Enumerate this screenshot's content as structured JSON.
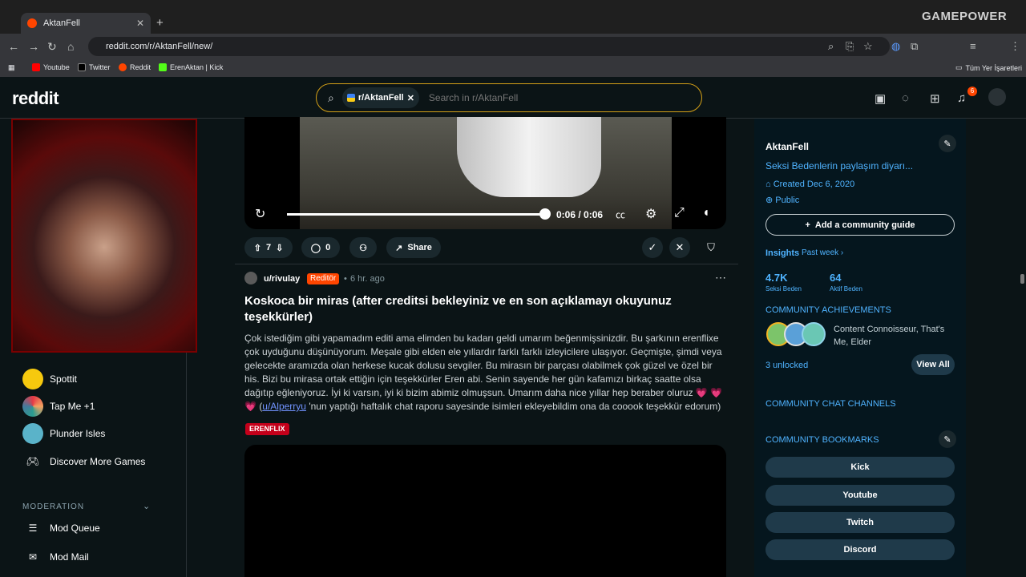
{
  "browser": {
    "tab_title": "AktanFell",
    "url": "reddit.com/r/AktanFell/new/",
    "bookmarks": [
      "Youtube",
      "Twitter",
      "Reddit",
      "ErenAktan | Kick"
    ],
    "bookmarks_all": "Tüm Yer İşaretleri",
    "overlay_brand": "GAMEPOWER"
  },
  "header": {
    "logo": "reddit",
    "search_chip": "r/AktanFell",
    "search_placeholder": "Search in r/AktanFell",
    "notification_count": "6"
  },
  "left_sidebar": {
    "games": [
      {
        "label": "Spottit"
      },
      {
        "label": "Tap Me +1"
      },
      {
        "label": "Plunder Isles"
      },
      {
        "label": "Discover More Games"
      }
    ],
    "moderation_heading": "MODERATION",
    "mod_items": [
      {
        "label": "Mod Queue"
      },
      {
        "label": "Mod Mail"
      }
    ]
  },
  "video_player": {
    "time": "0:06 / 0:06"
  },
  "prev_post_actions": {
    "votes": "7",
    "comments": "0",
    "share": "Share"
  },
  "post": {
    "author": "u/rivulay",
    "author_flair": "Reditör",
    "time": "6 hr. ago",
    "title": "Koskoca bir miras (after creditsi bekleyiniz ve en son açıklamayı okuyunuz teşekkürler)",
    "body_main": "Çok istediğim gibi yapamadım editi ama elimden bu kadarı geldi umarım beğenmişsinizdir. Bu şarkının erenflixe çok uyduğunu düşünüyorum. Meşale gibi elden ele yıllardır farklı farklı izleyicilere ulaşıyor. Geçmişte, şimdi veya gelecekte aramızda olan herkese kucak dolusu sevgiler. Bu mirasın bir parçası olabilmek çok güzel ve özel bir his. Bizi bu mirasa ortak ettiğin için teşekkürler Eren abi. Senin sayende her gün kafamızı birkaç saatte olsa dağıtıp eğleniyoruz. İyi ki varsın, iyi ki bizim abimiz olmuşsun. Umarım daha nice yıllar hep beraber oluruz 💗 💗 💗 (",
    "body_mention": "u/Alperryu",
    "body_end": " 'nun yaptığı haftalık chat raporu sayesinde isimleri ekleyebildim ona da cooook teşekkür edorum)",
    "flair": "ERENFLIX"
  },
  "right_sidebar": {
    "name": "AktanFell",
    "description": "Seksi Bedenlerin paylaşım diyarı...",
    "created": "Created Dec 6, 2020",
    "visibility": "Public",
    "add_guide": "Add a community guide",
    "insights": "Insights",
    "insights_period": "Past week",
    "stat1_value": "4.7K",
    "stat1_label": "Seksi Beden",
    "stat2_value": "64",
    "stat2_label": "Aktif Beden",
    "achievements_heading": "COMMUNITY ACHIEVEMENTS",
    "achievements_text": "Content Connoisseur, That's Me, Elder",
    "unlocked": "3 unlocked",
    "view_all": "View All",
    "chat_heading": "COMMUNITY CHAT CHANNELS",
    "bookmarks_heading": "COMMUNITY BOOKMARKS",
    "bookmarks": [
      "Kick",
      "Youtube",
      "Twitch",
      "Discord"
    ]
  },
  "colors": {
    "accent": "#ff4500",
    "link": "#7193ff",
    "background": "#0b1416",
    "sidebar_bg": "#05161e"
  }
}
